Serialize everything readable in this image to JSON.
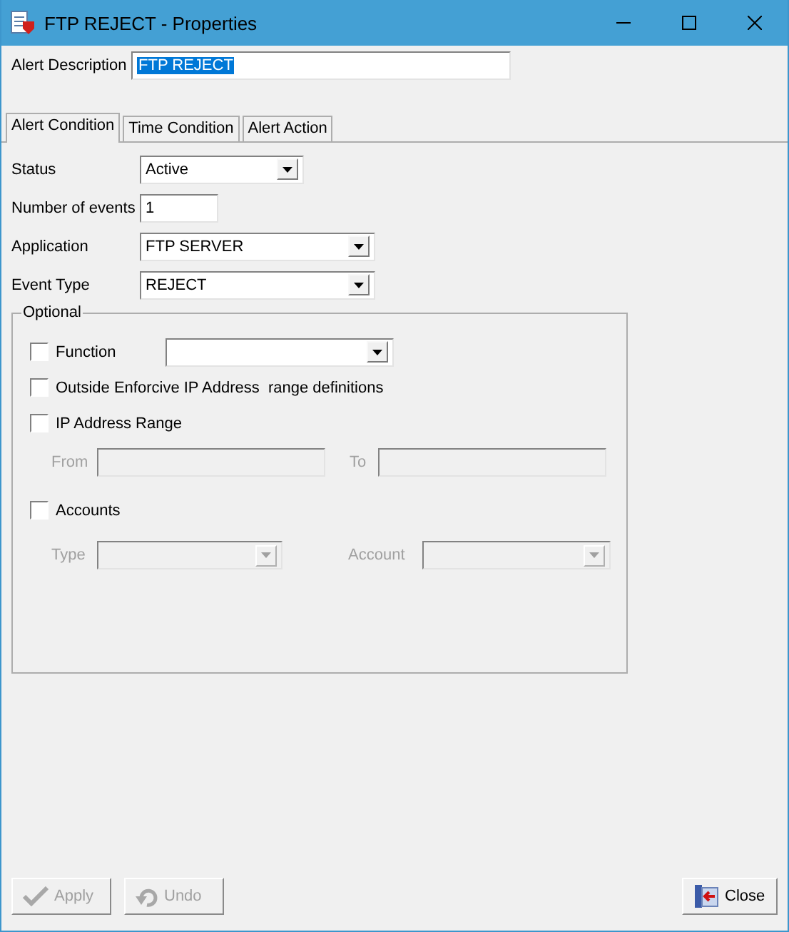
{
  "window": {
    "title": "FTP REJECT - Properties"
  },
  "alert_description": {
    "label": "Alert Description",
    "value": "FTP REJECT",
    "selected": true
  },
  "tabs": [
    {
      "label": "Alert Condition",
      "selected": true
    },
    {
      "label": "Time Condition",
      "selected": false
    },
    {
      "label": "Alert Action",
      "selected": false
    }
  ],
  "fields": [
    {
      "label": "Status",
      "kind": "dropdown",
      "value": "Active"
    },
    {
      "label": "Number of events",
      "kind": "input",
      "value": "1"
    },
    {
      "label": "Application",
      "kind": "dropdown",
      "value": "FTP SERVER"
    },
    {
      "label": "Event Type",
      "kind": "dropdown",
      "value": "REJECT"
    }
  ],
  "optional": {
    "title": "Optional",
    "items": [
      {
        "kind": "dropdown",
        "label": "Function",
        "checked": false
      },
      {
        "kind": "plain",
        "label": "Outside Enforcive IP Address  range definitions",
        "checked": false
      },
      {
        "kind": "range",
        "label": "IP Address Range",
        "checked": false,
        "subfields": [
          {
            "label": "From",
            "disabled": true
          },
          {
            "label": "To",
            "disabled": true
          }
        ]
      },
      {
        "kind": "combos",
        "label": "Accounts",
        "checked": false,
        "subfields": [
          {
            "label": "Type",
            "disabled": true
          },
          {
            "label": "Account",
            "disabled": true
          }
        ]
      }
    ]
  },
  "buttons": [
    {
      "kind": "apply",
      "label": "Apply",
      "disabled": true
    },
    {
      "kind": "undo",
      "label": "Undo",
      "disabled": true
    },
    {
      "kind": "close",
      "label": "Close",
      "disabled": false
    }
  ]
}
